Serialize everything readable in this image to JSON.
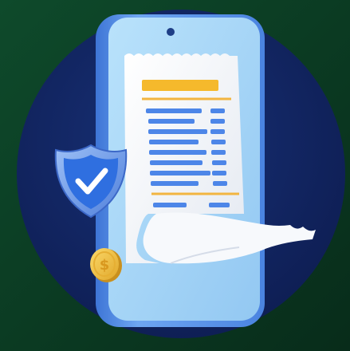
{
  "scene": {
    "subject": "phone-with-receipt-illustration",
    "background_color": "#0B3A22",
    "circle_color": "#12245E",
    "phone_color": "#5E95E6",
    "screen_color": "#A9D7F7",
    "receipt_color": "#F3F5F8",
    "accent_yellow": "#F5B92C",
    "line_blue": "#4D86E8",
    "shield_color": "#5D8FE8",
    "check_color": "#FFFFFF",
    "coin_color": "#F3C64A",
    "coin_symbol": "$"
  }
}
